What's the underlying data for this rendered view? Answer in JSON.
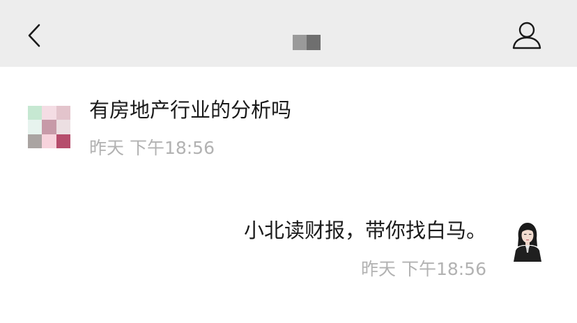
{
  "header": {
    "back_icon": "chevron-left-icon",
    "title_mosaic_colors": [
      "#9a9a9a",
      "#6f6f6f"
    ],
    "profile_icon": "person-icon"
  },
  "messages": [
    {
      "direction": "incoming",
      "avatar_mosaic_colors": [
        "#c6e8d2",
        "#f4dde4",
        "#e3c4cc",
        "#e7f3ee",
        "#c79aa8",
        "#ecdfe2",
        "#aaa4a2",
        "#f7d3dc",
        "#b64d6c"
      ],
      "text": "有房地产行业的分析吗",
      "time": "昨天 下午18:56"
    },
    {
      "direction": "outgoing",
      "avatar_icon": "businesswoman-avatar",
      "text": "小北读财报，带你找白马。",
      "time": "昨天 下午18:56"
    }
  ]
}
